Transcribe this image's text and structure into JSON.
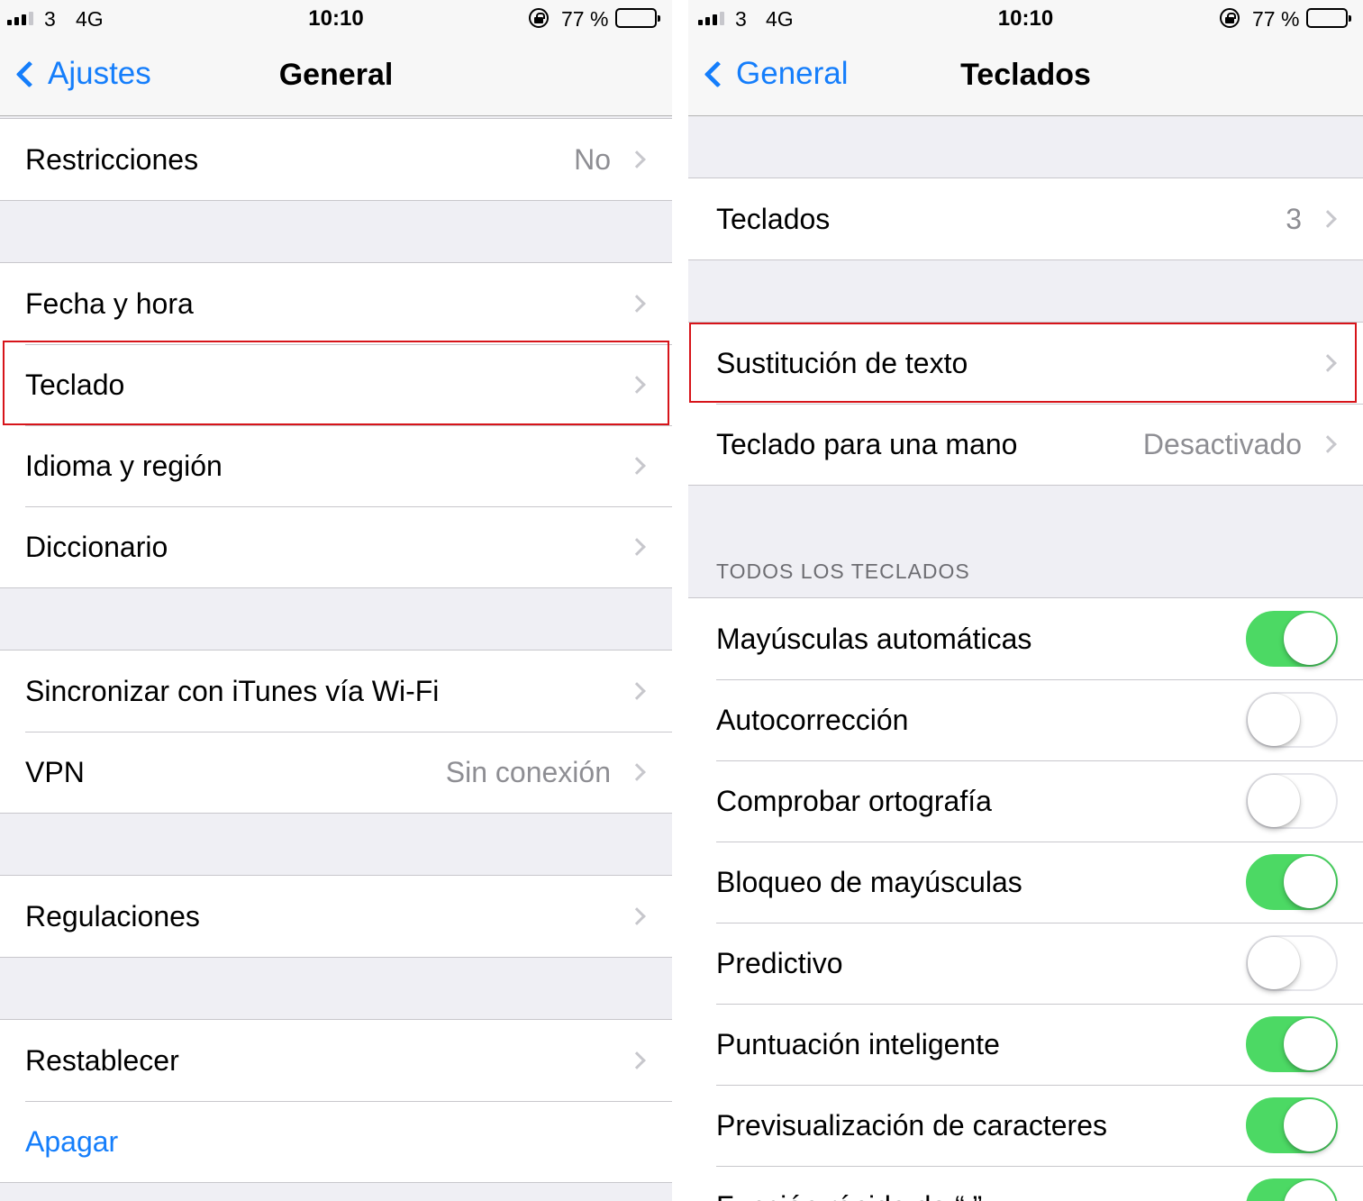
{
  "left": {
    "status": {
      "carrier": "3",
      "network": "4G",
      "time": "10:10",
      "battery_percent": "77 %",
      "battery_level": 0.77
    },
    "nav": {
      "back": "Ajustes",
      "title": "General"
    },
    "cells": {
      "restricciones": {
        "label": "Restricciones",
        "value": "No"
      },
      "fecha": {
        "label": "Fecha y hora"
      },
      "teclado": {
        "label": "Teclado"
      },
      "idioma": {
        "label": "Idioma y región"
      },
      "diccionario": {
        "label": "Diccionario"
      },
      "itunes": {
        "label": "Sincronizar con iTunes vía Wi-Fi"
      },
      "vpn": {
        "label": "VPN",
        "value": "Sin conexión"
      },
      "regulaciones": {
        "label": "Regulaciones"
      },
      "restablecer": {
        "label": "Restablecer"
      },
      "apagar": {
        "label": "Apagar"
      }
    }
  },
  "right": {
    "status": {
      "carrier": "3",
      "network": "4G",
      "time": "10:10",
      "battery_percent": "77 %",
      "battery_level": 0.77
    },
    "nav": {
      "back": "General",
      "title": "Teclados"
    },
    "cells": {
      "teclados": {
        "label": "Teclados",
        "value": "3"
      },
      "sustitucion": {
        "label": "Sustitución de texto"
      },
      "una_mano": {
        "label": "Teclado para una mano",
        "value": "Desactivado"
      }
    },
    "section_header": "TODOS LOS TECLADOS",
    "toggles": [
      {
        "label": "Mayúsculas automáticas",
        "on": true
      },
      {
        "label": "Autocorrección",
        "on": false
      },
      {
        "label": "Comprobar ortografía",
        "on": false
      },
      {
        "label": "Bloqueo de mayúsculas",
        "on": true
      },
      {
        "label": "Predictivo",
        "on": false
      },
      {
        "label": "Puntuación inteligente",
        "on": true
      },
      {
        "label": "Previsualización de caracteres",
        "on": true
      },
      {
        "label": "Función rápida de “.”",
        "on": true
      }
    ]
  },
  "colors": {
    "accent": "#157efb",
    "switch_on": "#4cd964",
    "highlight": "#d7141a"
  }
}
